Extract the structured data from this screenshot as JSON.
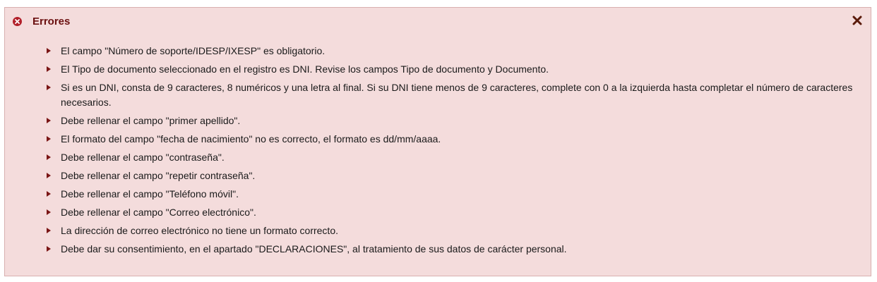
{
  "panel": {
    "title": "Errores",
    "icon": "error-circle-icon",
    "close_icon": "close-icon",
    "accent_color": "#b2202a",
    "background_color": "#f4dcdc",
    "errors": [
      "El campo \"Número de soporte/IDESP/IXESP\" es obligatorio.",
      "El Tipo de documento seleccionado en el registro es DNI. Revise los campos Tipo de documento y Documento.",
      "Si es un DNI, consta de 9 caracteres, 8 numéricos y una letra al final. Si su DNI tiene menos de 9 caracteres, complete con 0 a la izquierda hasta completar el número de caracteres necesarios.",
      "Debe rellenar el campo \"primer apellido\".",
      "El formato del campo \"fecha de nacimiento\" no es correcto, el formato es dd/mm/aaaa.",
      "Debe rellenar el campo \"contraseña\".",
      "Debe rellenar el campo \"repetir contraseña\".",
      "Debe rellenar el campo \"Teléfono móvil\".",
      "Debe rellenar el campo \"Correo electrónico\".",
      "La dirección de correo electrónico no tiene un formato correcto.",
      "Debe dar su consentimiento, en el apartado \"DECLARACIONES\", al tratamiento de sus datos de carácter personal."
    ]
  }
}
